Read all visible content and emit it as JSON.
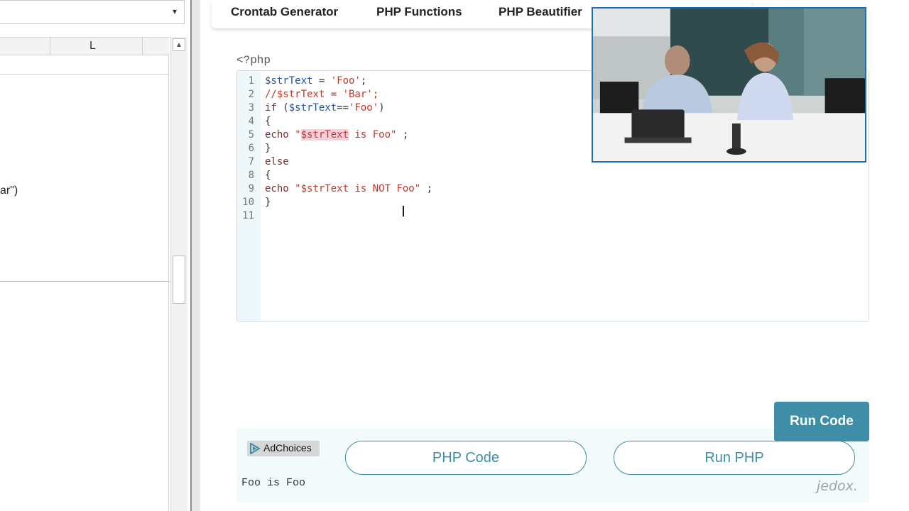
{
  "spreadsheet": {
    "column_header": "L",
    "cell_fragment": "ar\")"
  },
  "nav": {
    "items": [
      "Crontab Generator",
      "PHP Functions",
      "PHP Beautifier"
    ]
  },
  "editor": {
    "php_open_tag": "<?php",
    "line_numbers": [
      "1",
      "2",
      "3",
      "4",
      "5",
      "6",
      "7",
      "8",
      "9",
      "10",
      "11"
    ],
    "lines": {
      "l1": {
        "var": "$strText",
        "eq": " = ",
        "str": "'Foo'",
        "end": ";"
      },
      "l2": {
        "comment": "//$strText = 'Bar';"
      },
      "l3": {
        "kw": "if",
        "open": " (",
        "var": "$strText",
        "op": "==",
        "str": "'Foo'",
        "close": ")"
      },
      "l4": {
        "text": "{"
      },
      "l5": {
        "kw": "echo",
        "sp": " ",
        "q1": "\"",
        "sel": "$strText",
        "rest": " is Foo\"",
        "end": " ;"
      },
      "l6": {
        "text": "}"
      },
      "l7": {
        "kw": "else"
      },
      "l8": {
        "text": "{"
      },
      "l9": {
        "kw": "echo",
        "sp": " ",
        "str": "\"$strText is NOT Foo\"",
        "end": " ;"
      },
      "l10": {
        "text": "}"
      }
    }
  },
  "buttons": {
    "run_code": "Run Code",
    "php_code": "PHP Code",
    "run_php": "Run PHP"
  },
  "ad": {
    "label": "AdChoices"
  },
  "output": {
    "text": "Foo is Foo"
  },
  "watermark": "jedox.",
  "colors": {
    "accent": "#3e8ea7",
    "variable": "#1e56a8",
    "string": "#c0392b",
    "selection": "#f5cfdc"
  },
  "icons": {
    "combo_arrow": "chevron-down-icon",
    "scroll_up": "chevron-up-icon",
    "ad": "adchoices-icon",
    "cursor": "text-cursor-icon"
  }
}
